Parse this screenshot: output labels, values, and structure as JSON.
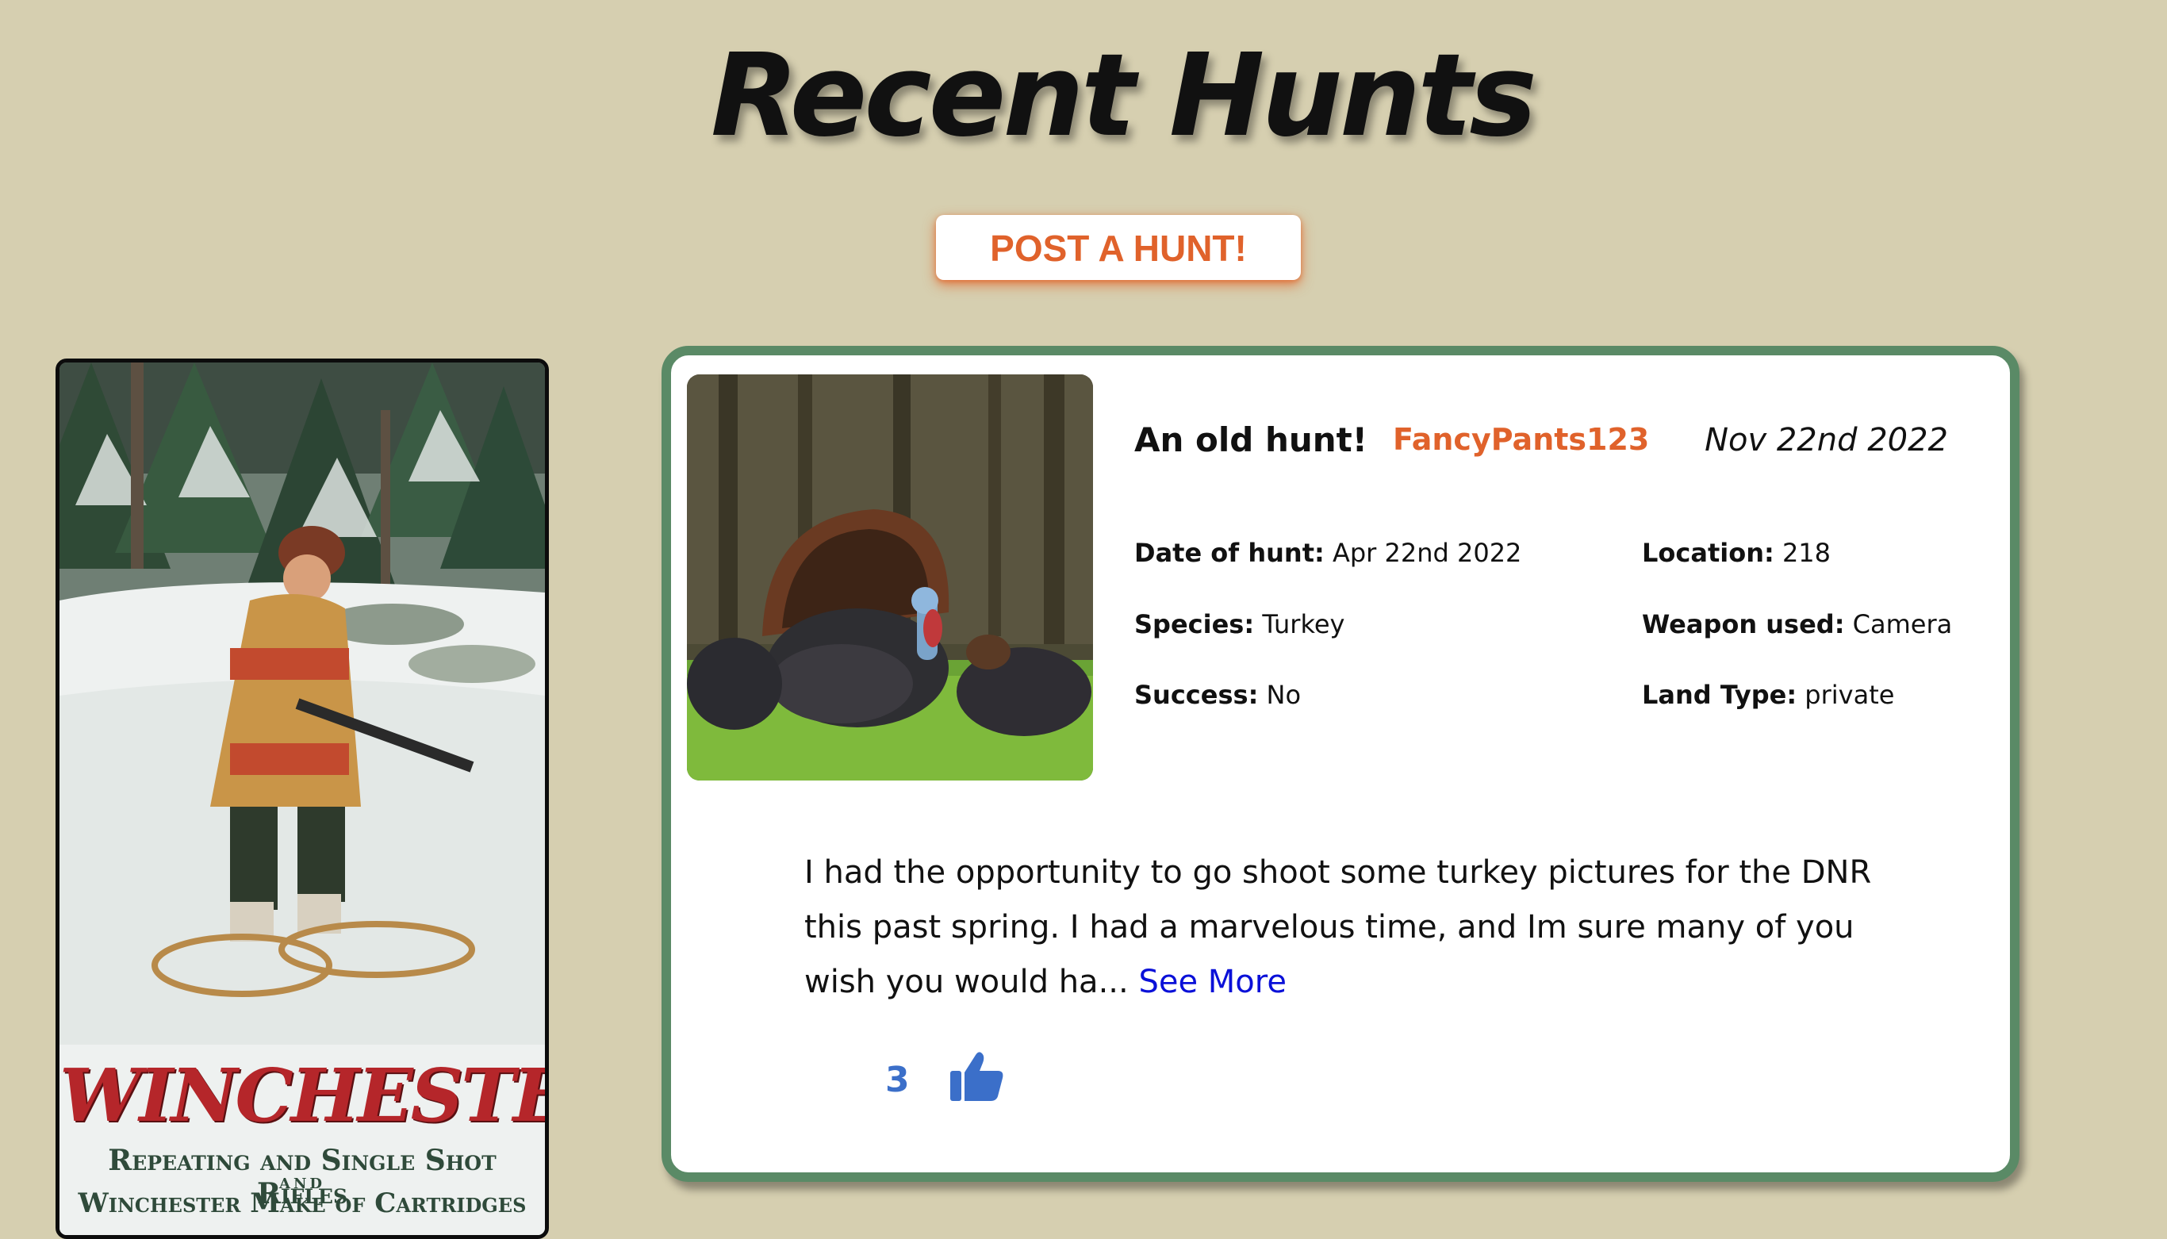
{
  "page": {
    "title": "Recent Hunts",
    "post_button_label": "POST A HUNT!"
  },
  "ad": {
    "brand": "WINCHESTER",
    "line1": "Repeating and Single Shot Rifles",
    "line_and": "AND",
    "line2": "Winchester Make of Cartridges"
  },
  "hunts": [
    {
      "title": "An old hunt!",
      "username": "FancyPants123",
      "posted_date": "Nov 22nd 2022",
      "date_of_hunt_label": "Date of hunt:",
      "date_of_hunt": "Apr 22nd 2022",
      "location_label": "Location:",
      "location": "218",
      "species_label": "Species:",
      "species": "Turkey",
      "weapon_label": "Weapon used:",
      "weapon": "Camera",
      "success_label": "Success:",
      "success": "No",
      "land_type_label": "Land Type:",
      "land_type": "private",
      "body": "I had the opportunity to go shoot some turkey pictures for the DNR this past spring. I had a marvelous time, and Im sure many of you wish you would ha...",
      "see_more_label": "See More",
      "likes": "3",
      "like_icon": "thumbs-up-icon"
    }
  ],
  "colors": {
    "background": "#d6cfb0",
    "accent": "#e0622b",
    "card_border": "#5a8a66",
    "link": "#0a10d8",
    "like": "#3b6fc9"
  }
}
